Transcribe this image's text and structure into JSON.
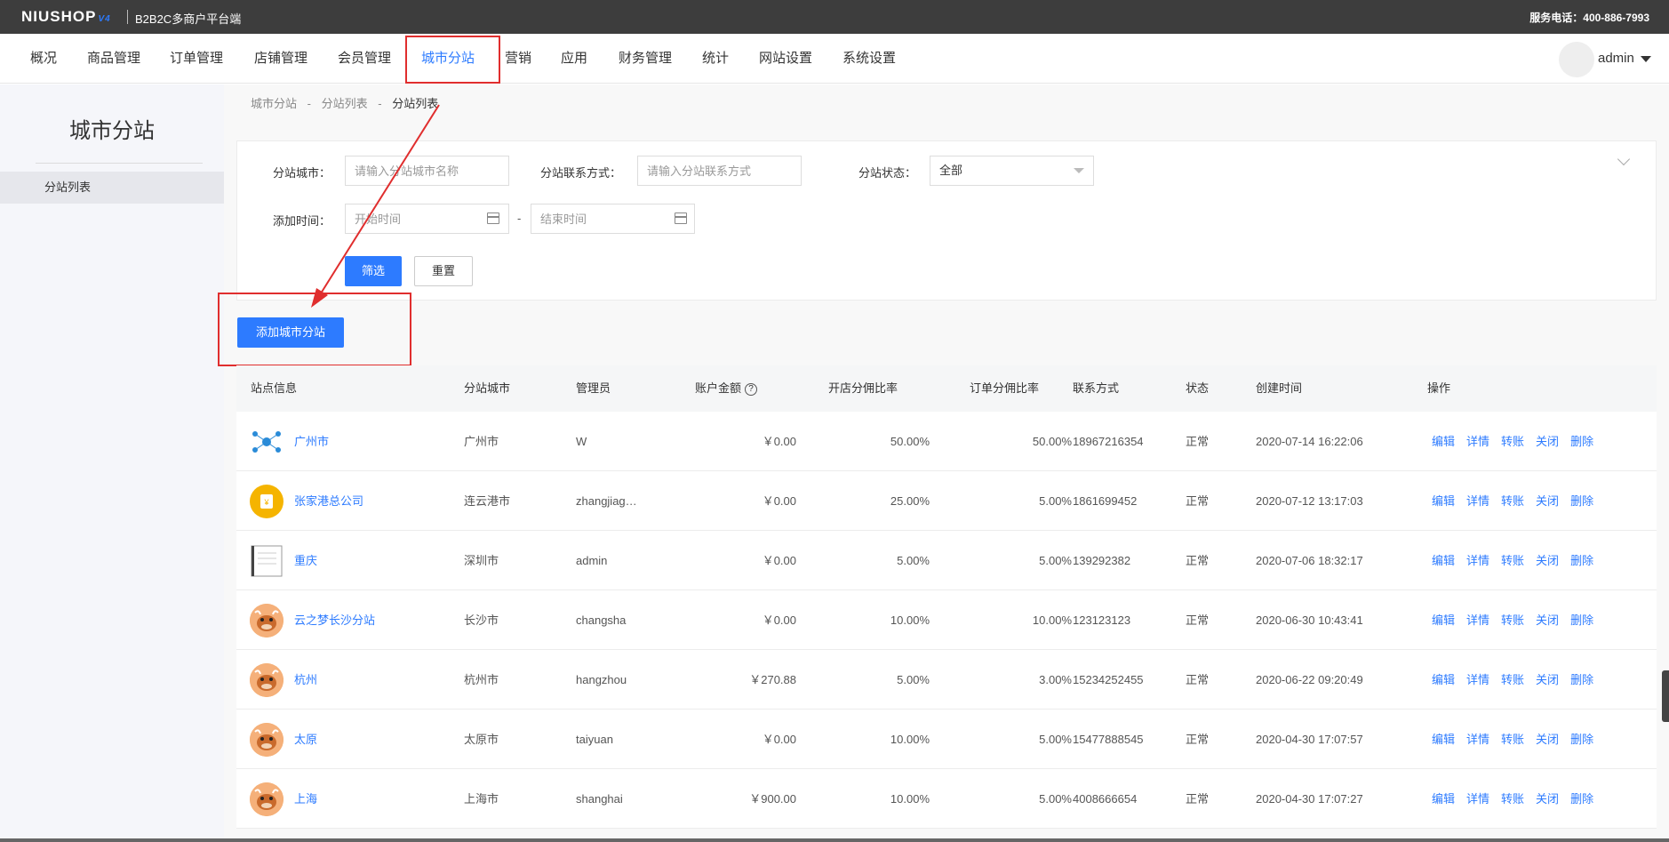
{
  "brand": {
    "logo": "NIUSHOP",
    "version": "V4",
    "subtitle": "B2B2C多商户平台端",
    "service_phone": "服务电话：400-886-7993"
  },
  "nav": {
    "items": [
      {
        "label": "概况",
        "active": false
      },
      {
        "label": "商品管理",
        "active": false
      },
      {
        "label": "订单管理",
        "active": false
      },
      {
        "label": "店铺管理",
        "active": false
      },
      {
        "label": "会员管理",
        "active": false
      },
      {
        "label": "城市分站",
        "active": true
      },
      {
        "label": "营销",
        "active": false
      },
      {
        "label": "应用",
        "active": false
      },
      {
        "label": "财务管理",
        "active": false
      },
      {
        "label": "统计",
        "active": false
      },
      {
        "label": "网站设置",
        "active": false
      },
      {
        "label": "系统设置",
        "active": false
      }
    ],
    "user": "admin"
  },
  "sidebar": {
    "title": "城市分站",
    "items": [
      {
        "label": "分站列表",
        "active": true
      }
    ]
  },
  "breadcrumb": [
    "城市分站",
    "-",
    "分站列表",
    "-",
    "分站列表"
  ],
  "filter": {
    "city_label": "分站城市：",
    "city_placeholder": "请输入分站城市名称",
    "contact_label": "分站联系方式：",
    "contact_placeholder": "请输入分站联系方式",
    "status_label": "分站状态：",
    "status_value": "全部",
    "time_label": "添加时间：",
    "start_placeholder": "开始时间",
    "end_placeholder": "结束时间",
    "separator": "-",
    "search_button": "筛选",
    "reset_button": "重置"
  },
  "add_button": "添加城市分站",
  "table": {
    "headers": [
      "站点信息",
      "分站城市",
      "管理员",
      "账户金额",
      "开店分佣比率",
      "订单分佣比率",
      "联系方式",
      "状态",
      "创建时间",
      "操作"
    ],
    "rows": [
      {
        "name": "广州市",
        "city": "广州市",
        "admin": "W",
        "amount": "￥0.00",
        "shop_rate": "50.00%",
        "order_rate": "50.00%",
        "contact": "18967216354",
        "status": "正常",
        "created": "2020-07-14 16:22:06",
        "avatar": "network-avatar"
      },
      {
        "name": "张家港总公司",
        "city": "连云港市",
        "admin": "zhangjiag…",
        "amount": "￥0.00",
        "shop_rate": "25.00%",
        "order_rate": "5.00%",
        "contact": "1861699452",
        "status": "正常",
        "created": "2020-07-12 13:17:03",
        "avatar": "gold-bag-avatar"
      },
      {
        "name": "重庆",
        "city": "深圳市",
        "admin": "admin",
        "amount": "￥0.00",
        "shop_rate": "5.00%",
        "order_rate": "5.00%",
        "contact": "139292382",
        "status": "正常",
        "created": "2020-07-06 18:32:17",
        "avatar": "document-avatar"
      },
      {
        "name": "云之梦长沙分站",
        "city": "长沙市",
        "admin": "changsha",
        "amount": "￥0.00",
        "shop_rate": "10.00%",
        "order_rate": "10.00%",
        "contact": "123123123",
        "status": "正常",
        "created": "2020-06-30 10:43:41",
        "avatar": "cow-avatar"
      },
      {
        "name": "杭州",
        "city": "杭州市",
        "admin": "hangzhou",
        "amount": "￥270.88",
        "shop_rate": "5.00%",
        "order_rate": "3.00%",
        "contact": "15234252455",
        "status": "正常",
        "created": "2020-06-22 09:20:49",
        "avatar": "cow-avatar"
      },
      {
        "name": "太原",
        "city": "太原市",
        "admin": "taiyuan",
        "amount": "￥0.00",
        "shop_rate": "10.00%",
        "order_rate": "5.00%",
        "contact": "15477888545",
        "status": "正常",
        "created": "2020-04-30 17:07:57",
        "avatar": "cow-avatar"
      },
      {
        "name": "上海",
        "city": "上海市",
        "admin": "shanghai",
        "amount": "￥900.00",
        "shop_rate": "10.00%",
        "order_rate": "5.00%",
        "contact": "4008666654",
        "status": "正常",
        "created": "2020-04-30 17:07:27",
        "avatar": "cow-avatar"
      }
    ],
    "actions": [
      "编辑",
      "详情",
      "转账",
      "关闭",
      "删除"
    ]
  },
  "colors": {
    "primary": "#2d7bff",
    "topbar": "#3d3d3d",
    "highlight": "#e02e2e"
  }
}
